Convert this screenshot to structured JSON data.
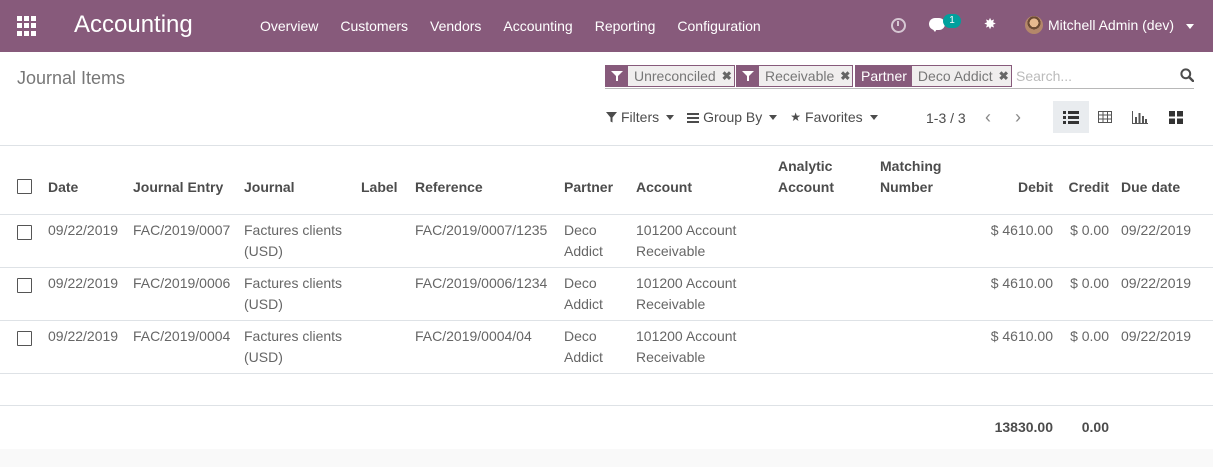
{
  "app": {
    "title": "Accounting",
    "menu": [
      "Overview",
      "Customers",
      "Vendors",
      "Accounting",
      "Reporting",
      "Configuration"
    ],
    "chat_badge": "1",
    "user": "Mitchell Admin (dev)"
  },
  "control_panel": {
    "title": "Journal Items",
    "facets": [
      {
        "type": "filter",
        "value": "Unreconciled"
      },
      {
        "type": "filter",
        "value": "Receivable"
      },
      {
        "type": "field",
        "category": "Partner",
        "value": "Deco Addict"
      }
    ],
    "search_placeholder": "Search...",
    "filters_label": "Filters",
    "groupby_label": "Group By",
    "favorites_label": "Favorites",
    "pager": "1-3 / 3"
  },
  "table": {
    "columns": {
      "date": "Date",
      "journal_entry": "Journal Entry",
      "journal": "Journal",
      "label": "Label",
      "reference": "Reference",
      "partner": "Partner",
      "account": "Account",
      "analytic_account": "Analytic Account",
      "matching_number": "Matching Number",
      "debit": "Debit",
      "credit": "Credit",
      "due_date": "Due date"
    },
    "rows": [
      {
        "date": "09/22/2019",
        "journal_entry": "FAC/2019/0007",
        "journal": "Factures clients (USD)",
        "label": "",
        "reference": "FAC/2019/0007/1235",
        "partner": "Deco Addict",
        "account": "101200 Account Receivable",
        "analytic_account": "",
        "matching_number": "",
        "debit": "$ 4610.00",
        "credit": "$ 0.00",
        "due_date": "09/22/2019"
      },
      {
        "date": "09/22/2019",
        "journal_entry": "FAC/2019/0006",
        "journal": "Factures clients (USD)",
        "label": "",
        "reference": "FAC/2019/0006/1234",
        "partner": "Deco Addict",
        "account": "101200 Account Receivable",
        "analytic_account": "",
        "matching_number": "",
        "debit": "$ 4610.00",
        "credit": "$ 0.00",
        "due_date": "09/22/2019"
      },
      {
        "date": "09/22/2019",
        "journal_entry": "FAC/2019/0004",
        "journal": "Factures clients (USD)",
        "label": "",
        "reference": "FAC/2019/0004/04",
        "partner": "Deco Addict",
        "account": "101200 Account Receivable",
        "analytic_account": "",
        "matching_number": "",
        "debit": "$ 4610.00",
        "credit": "$ 0.00",
        "due_date": "09/22/2019"
      }
    ],
    "totals": {
      "debit": "13830.00",
      "credit": "0.00"
    }
  },
  "colors": {
    "brand": "#875a7b",
    "badge": "#00a09d"
  }
}
